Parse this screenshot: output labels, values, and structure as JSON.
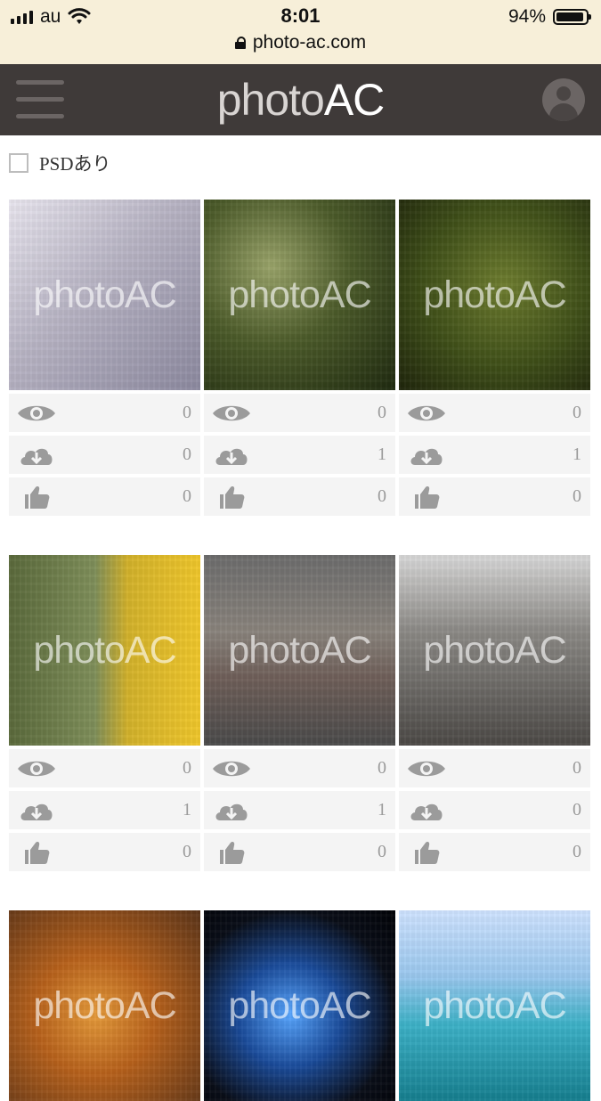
{
  "status_bar": {
    "carrier": "au",
    "time": "8:01",
    "battery": "94%",
    "url": "photo-ac.com"
  },
  "header": {
    "logo_part1": "photo",
    "logo_part2": "AC"
  },
  "filter": {
    "psd_label": "PSDあり"
  },
  "watermark_text": "photoAC",
  "photos": [
    {
      "views": "0",
      "downloads": "0",
      "likes": "0"
    },
    {
      "views": "0",
      "downloads": "1",
      "likes": "0"
    },
    {
      "views": "0",
      "downloads": "1",
      "likes": "0"
    },
    {
      "views": "0",
      "downloads": "1",
      "likes": "0"
    },
    {
      "views": "0",
      "downloads": "1",
      "likes": "0"
    },
    {
      "views": "0",
      "downloads": "0",
      "likes": "0"
    },
    {
      "views": "",
      "downloads": "",
      "likes": ""
    },
    {
      "views": "",
      "downloads": "",
      "likes": ""
    },
    {
      "views": "",
      "downloads": "",
      "likes": ""
    }
  ],
  "icons": {
    "menu": "hamburger-icon",
    "user": "user-icon",
    "view": "eye-icon",
    "download": "cloud-download-icon",
    "like": "thumbs-up-icon",
    "lock": "lock-icon"
  }
}
